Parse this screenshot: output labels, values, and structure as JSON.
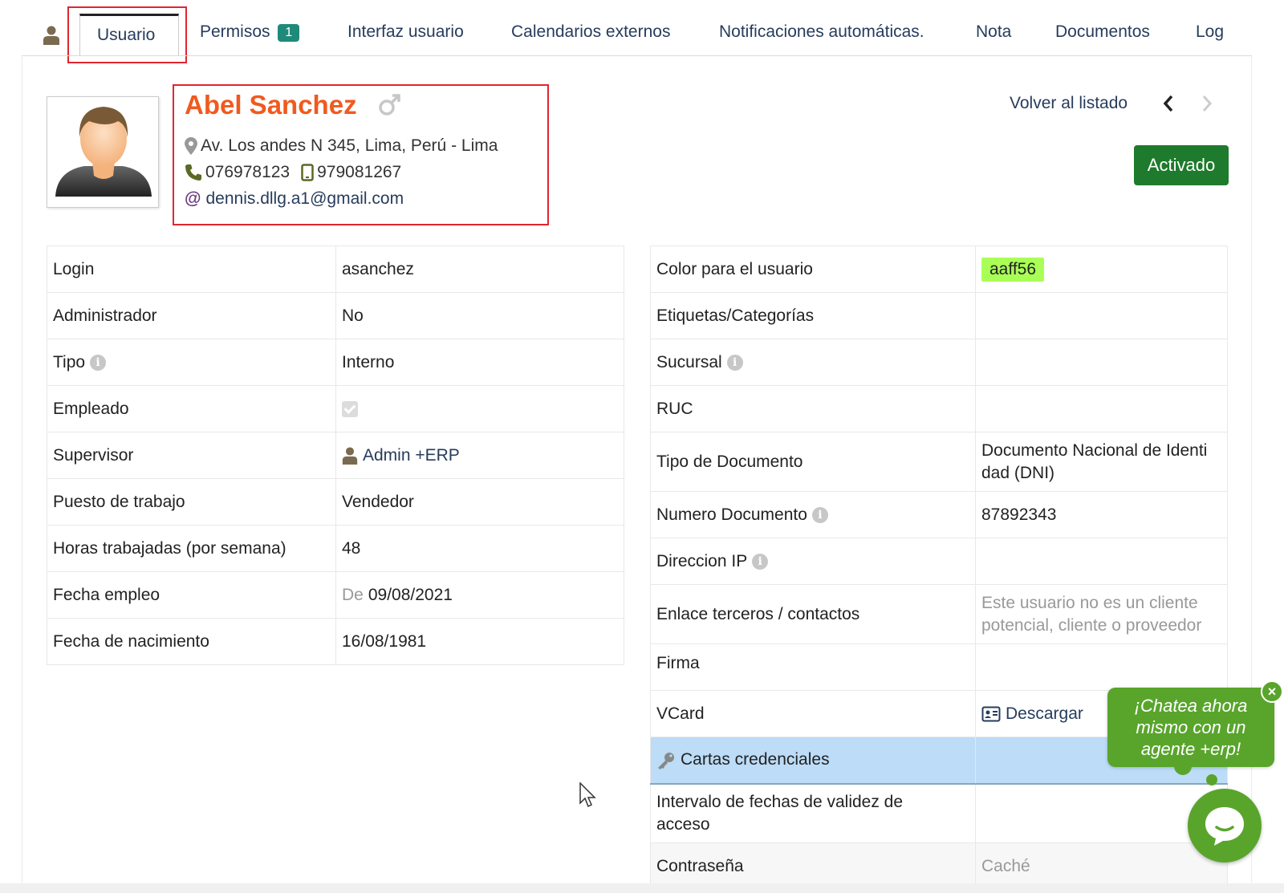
{
  "tabs": {
    "items": [
      {
        "label": "Usuario",
        "active": true
      },
      {
        "label": "Permisos",
        "badge": "1"
      },
      {
        "label": "Interfaz usuario"
      },
      {
        "label": "Calendarios externos"
      },
      {
        "label": "Notificaciones automáticas."
      },
      {
        "label": "Nota"
      },
      {
        "label": "Documentos"
      },
      {
        "label": "Log"
      }
    ]
  },
  "header": {
    "name": "Abel Sanchez",
    "address": "Av. Los andes N 345, Lima, Perú - Lima",
    "phone": "076978123",
    "mobile": "979081267",
    "email": "dennis.dllg.a1@gmail.com",
    "back_label": "Volver al listado",
    "status": "Activado"
  },
  "left_fields": [
    {
      "label": "Login",
      "value": "asanchez"
    },
    {
      "label": "Administrador",
      "value": "No"
    },
    {
      "label": "Tipo",
      "value": "Interno"
    },
    {
      "label": "Empleado",
      "value": ""
    },
    {
      "label": "Supervisor",
      "value": "Admin +ERP"
    },
    {
      "label": "Puesto de trabajo",
      "value": "Vendedor"
    },
    {
      "label": "Horas trabajadas (por semana)",
      "value": "48"
    },
    {
      "label": "Fecha empleo",
      "prefix": "De",
      "value": "09/08/2021"
    },
    {
      "label": "Fecha de nacimiento",
      "value": "16/08/1981"
    }
  ],
  "right_fields": [
    {
      "label": "Color para el usuario",
      "value": "aaff56"
    },
    {
      "label": "Etiquetas/Categorías",
      "value": ""
    },
    {
      "label": "Sucursal",
      "value": ""
    },
    {
      "label": "RUC",
      "value": ""
    },
    {
      "label": "Tipo de Documento",
      "value_line1": "Documento Nacional de Identi",
      "value_line2": "dad (DNI)"
    },
    {
      "label": "Numero Documento",
      "value": "87892343"
    },
    {
      "label": "Direccion IP",
      "value": ""
    },
    {
      "label": "Enlace terceros / contactos",
      "value_line1": "Este usuario no es un cliente",
      "value_line2": "potencial, cliente o proveedor"
    },
    {
      "label": "Firma",
      "value": ""
    },
    {
      "label": "VCard",
      "value": "Descargar"
    },
    {
      "label": "Cartas credenciales",
      "value": ""
    },
    {
      "label_line1": "Intervalo de fechas de validez de",
      "label_line2": "acceso",
      "value": ""
    },
    {
      "label": "Contraseña",
      "value": "Caché"
    }
  ],
  "colors": {
    "user_color": "#aaff56",
    "accent_orange": "#f05a1e",
    "status_green": "#1e7a2c",
    "badge_teal": "#1f8a79",
    "chat_green": "#59a52c"
  },
  "chat": {
    "line1": "¡Chatea ahora",
    "line2": "mismo con un",
    "line3": "agente +erp!",
    "close": "×"
  }
}
